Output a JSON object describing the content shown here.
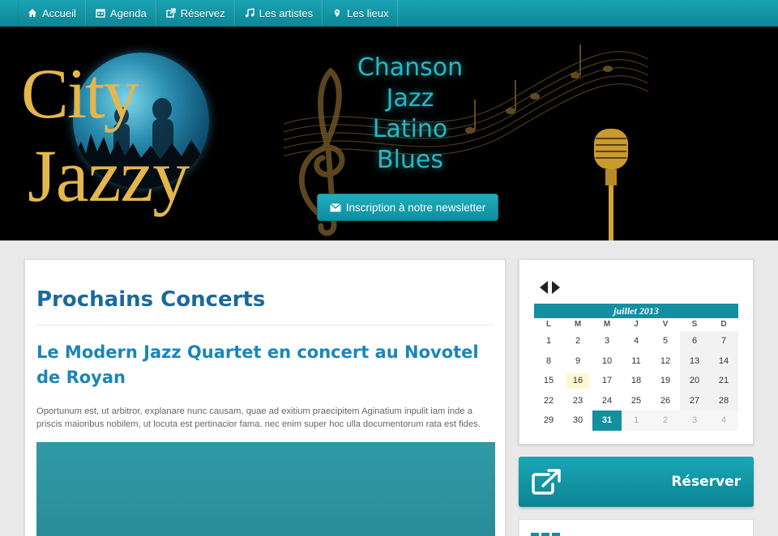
{
  "nav": {
    "items": [
      {
        "label": "Accueil",
        "icon": "home-icon"
      },
      {
        "label": "Agenda",
        "icon": "calendar-icon"
      },
      {
        "label": "Réservez",
        "icon": "external-link-icon"
      },
      {
        "label": "Les artistes",
        "icon": "music-note-icon"
      },
      {
        "label": "Les lieux",
        "icon": "map-marker-icon"
      }
    ]
  },
  "banner": {
    "logo_line1": "City",
    "logo_line2": "Jazzy",
    "genres": [
      "Chanson",
      "Jazz",
      "Latino",
      "Blues"
    ],
    "newsletter_label": "Inscription à notre newsletter"
  },
  "main": {
    "section_title": "Prochains Concerts",
    "article_title": "Le Modern Jazz Quartet en concert au Novotel de Royan",
    "article_text": "Oportunum est, ut arbitror, explanare nunc causam, quae ad exitium praecipitem Aginatium inpulit iam inde a priscis maioribus nobilem, ut locuta est pertinacior fama. nec enim super hoc ulla documentorum rata est fides."
  },
  "calendar": {
    "month_label": "juillet 2013",
    "weekdays": [
      "L",
      "M",
      "M",
      "J",
      "V",
      "S",
      "D"
    ],
    "weeks": [
      [
        "1",
        "2",
        "3",
        "4",
        "5",
        "6",
        "7"
      ],
      [
        "8",
        "9",
        "10",
        "11",
        "12",
        "13",
        "14"
      ],
      [
        "15",
        "16",
        "17",
        "18",
        "19",
        "20",
        "21"
      ],
      [
        "22",
        "23",
        "24",
        "25",
        "26",
        "27",
        "28"
      ],
      [
        "29",
        "30",
        "31",
        "1",
        "2",
        "3",
        "4"
      ]
    ],
    "highlighted_day": "16",
    "selected_day": "31"
  },
  "sidebar": {
    "reserve_label": "Réserver"
  },
  "colors": {
    "accent": "#138fa0",
    "title_blue": "#1a6a9a",
    "logo_gold": "#e3b64e"
  }
}
